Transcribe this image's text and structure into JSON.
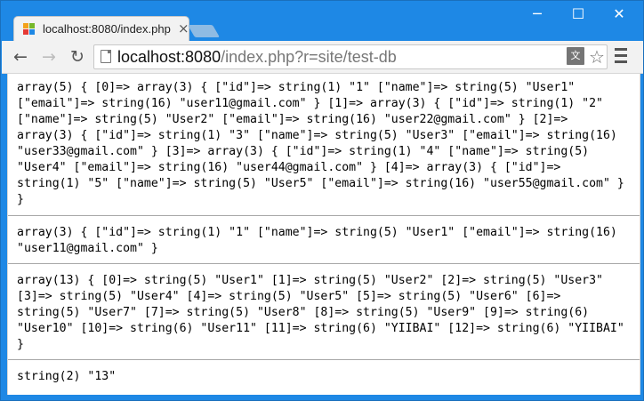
{
  "browser": {
    "tab_title": "localhost:8080/index.php",
    "close_glyph": "×",
    "url_host": "localhost:8080",
    "url_path": "/index.php?r=site/test-db",
    "window_controls": [
      "─",
      "☐",
      "✕"
    ],
    "toolbar_icons": [
      "back-icon",
      "forward-icon",
      "reload-icon",
      "translate-icon",
      "star-icon",
      "menu-icon"
    ],
    "accent": "#1e88e5"
  },
  "page": {
    "dump1": "array(5) { [0]=> array(3) { [\"id\"]=> string(1) \"1\" [\"name\"]=> string(5) \"User1\"\n[\"email\"]=> string(16) \"user11@gmail.com\" } [1]=> array(3) { [\"id\"]=> string(1) \"2\"\n[\"name\"]=> string(5) \"User2\" [\"email\"]=> string(16) \"user22@gmail.com\" } [2]=>\narray(3) { [\"id\"]=> string(1) \"3\" [\"name\"]=> string(5) \"User3\" [\"email\"]=> string(16)\n\"user33@gmail.com\" } [3]=> array(3) { [\"id\"]=> string(1) \"4\" [\"name\"]=> string(5)\n\"User4\" [\"email\"]=> string(16) \"user44@gmail.com\" } [4]=> array(3) { [\"id\"]=>\nstring(1) \"5\" [\"name\"]=> string(5) \"User5\" [\"email\"]=> string(16) \"user55@gmail.com\" }\n}",
    "dump2": "array(3) { [\"id\"]=> string(1) \"1\" [\"name\"]=> string(5) \"User1\" [\"email\"]=> string(16)\n\"user11@gmail.com\" }",
    "dump3": "array(13) { [0]=> string(5) \"User1\" [1]=> string(5) \"User2\" [2]=> string(5) \"User3\"\n[3]=> string(5) \"User4\" [4]=> string(5) \"User5\" [5]=> string(5) \"User6\" [6]=>\nstring(5) \"User7\" [7]=> string(5) \"User8\" [8]=> string(5) \"User9\" [9]=> string(6)\n\"User10\" [10]=> string(6) \"User11\" [11]=> string(6) \"YIIBAI\" [12]=> string(6) \"YIIBAI\"\n}",
    "dump4": "string(2) \"13\""
  }
}
